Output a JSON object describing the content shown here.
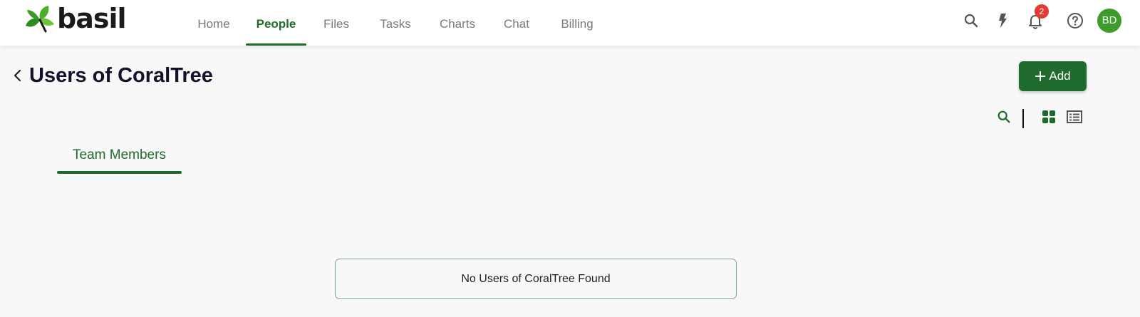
{
  "brand": {
    "name": "basil",
    "logo_icon": "leaf-logo-icon",
    "accent": "#1e6b2c"
  },
  "nav": {
    "items": [
      {
        "label": "Home",
        "active": false
      },
      {
        "label": "People",
        "active": true
      },
      {
        "label": "Files",
        "active": false
      },
      {
        "label": "Tasks",
        "active": false
      },
      {
        "label": "Charts",
        "active": false
      },
      {
        "label": "Chat",
        "active": false
      },
      {
        "label": "Billing",
        "active": false
      }
    ]
  },
  "topbar": {
    "icons": [
      "search-icon",
      "lightning-icon",
      "bell-icon",
      "help-icon"
    ],
    "notification_count": "2",
    "user_initials": "BD"
  },
  "page": {
    "title": "Users of CoralTree",
    "add_label": "Add"
  },
  "view_tools": [
    "search-icon",
    "grid-view-icon",
    "list-view-icon"
  ],
  "tabs": [
    {
      "label": "Team Members",
      "active": true
    }
  ],
  "empty_state": {
    "message": "No Users of CoralTree Found"
  }
}
